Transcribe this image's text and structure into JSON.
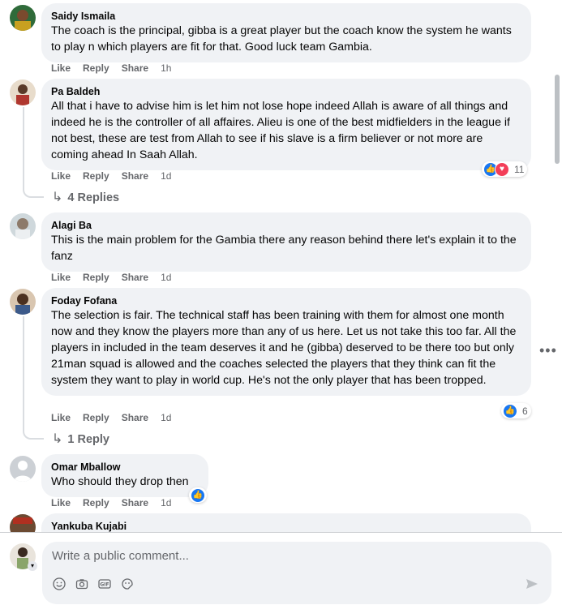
{
  "actions": {
    "like": "Like",
    "reply": "Reply",
    "share": "Share"
  },
  "comments": [
    {
      "author": "Saidy Ismaila",
      "text": "The coach is the principal, gibba is a great player but the coach know the system he wants to play n which players are fit for that. Good luck team Gambia.",
      "time": "1h"
    },
    {
      "author": "Pa Baldeh",
      "text": "All that i have to advise him is let him not lose hope indeed Allah is aware of all things and indeed he is the controller of all affaires. Alieu is one of the best midfielders in the league if not best, these are test from Allah to see if his slave is a firm believer or not more are coming ahead In Saah Allah.",
      "time": "1d",
      "reactions": "11",
      "replies": "4 Replies"
    },
    {
      "author": "Alagi Ba",
      "text": "This is the main problem for the Gambia there any reason behind there let's explain it to the fanz",
      "time": "1d"
    },
    {
      "author": "Foday Fofana",
      "text": "The selection is fair. The technical staff has been training with them for almost one month now and they know the players more than any of us here. Let us not take this too far. All the players in included in the team deserves it and he (gibba) deserved to be there too but only 21man squad is allowed and the coaches selected the players that they think can fit the system they want to play in world cup. He's not the only player that has been tropped.",
      "time": "1d",
      "reactions": "6",
      "replies": "1 Reply"
    },
    {
      "author": "Omar Mballow",
      "text": "Who should they drop then",
      "time": "1d"
    },
    {
      "author": "Yankuba Kujabi",
      "text": "",
      "time": ""
    }
  ],
  "composer": {
    "placeholder": "Write a public comment..."
  },
  "icons": {
    "like": "like-icon",
    "love": "love-icon",
    "more": "more-options-icon",
    "emoji": "emoji-icon",
    "camera": "camera-icon",
    "gif": "gif-icon",
    "sticker": "sticker-icon",
    "send": "send-icon"
  },
  "colors": {
    "accent": "#1877f2",
    "love": "#f33e58",
    "bubble": "#f0f2f5",
    "muted": "#65676b"
  }
}
